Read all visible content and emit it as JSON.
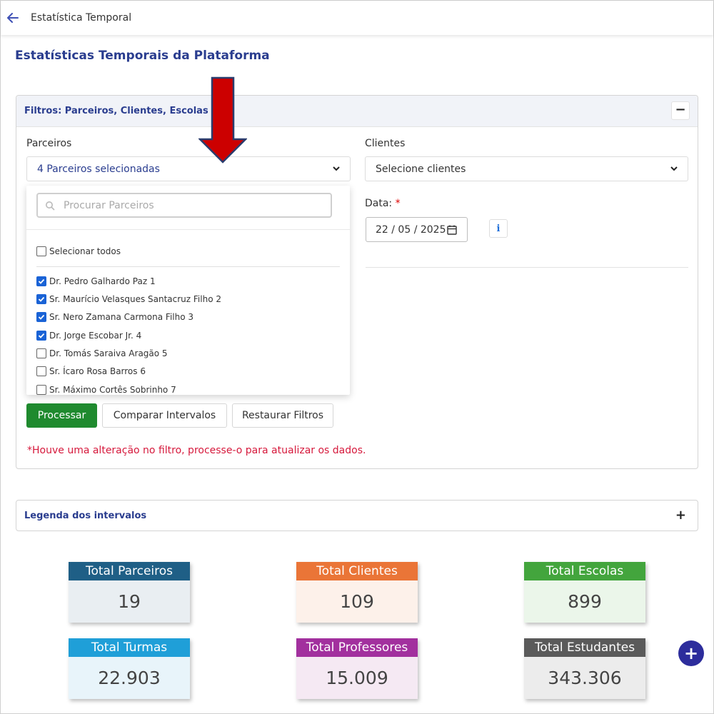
{
  "topbar": {
    "title": "Estatística Temporal"
  },
  "page": {
    "title": "Estatísticas Temporais da Plataforma"
  },
  "filters": {
    "header": "Filtros: Parceiros, Clientes, Escolas e D",
    "collapse_symbol": "−",
    "partners_label": "Parceiros",
    "partners_value": "4 Parceiros selecionadas",
    "clients_label": "Clientes",
    "clients_value": "Selecione clientes",
    "date_label": "Data:",
    "date_required": "*",
    "date_value": "22 / 05 / 2025",
    "info_symbol": "i",
    "dropdown": {
      "search_placeholder": "Procurar Parceiros",
      "select_all": "Selecionar todos",
      "items": [
        {
          "label": "Dr. Pedro Galhardo Paz 1",
          "checked": true
        },
        {
          "label": "Sr. Maurício Velasques Santacruz Filho 2",
          "checked": true
        },
        {
          "label": "Sr. Nero Zamana Carmona Filho 3",
          "checked": true
        },
        {
          "label": "Dr. Jorge Escobar Jr. 4",
          "checked": true
        },
        {
          "label": "Dr. Tomás Saraiva Aragão 5",
          "checked": false
        },
        {
          "label": "Sr. Ícaro Rosa Barros 6",
          "checked": false
        },
        {
          "label": "Sr. Máximo Cortês Sobrinho 7",
          "checked": false
        }
      ]
    },
    "buttons": {
      "process": "Processar",
      "compare": "Comparar Intervalos",
      "reset": "Restaurar Filtros"
    },
    "warning": "*Houve uma alteração no filtro, processe-o para atualizar os dados."
  },
  "legend": {
    "title": "Legenda dos intervalos",
    "expand_symbol": "+"
  },
  "stats": [
    {
      "label": "Total Parceiros",
      "value": "19",
      "header_color": "#1f5f86",
      "body_color": "#e9eef2"
    },
    {
      "label": "Total Clientes",
      "value": "109",
      "header_color": "#ea7537",
      "body_color": "#fdf1ea"
    },
    {
      "label": "Total Escolas",
      "value": "899",
      "header_color": "#43a53d",
      "body_color": "#ebf6ea"
    },
    {
      "label": "Total Turmas",
      "value": "22.903",
      "header_color": "#1f9fd8",
      "body_color": "#e8f4fa"
    },
    {
      "label": "Total Professores",
      "value": "15.009",
      "header_color": "#a2309e",
      "body_color": "#f5e9f3"
    },
    {
      "label": "Total Estudantes",
      "value": "343.306",
      "header_color": "#5a5a5a",
      "body_color": "#ececec"
    }
  ],
  "fab": {
    "symbol": "+"
  },
  "colors": {
    "accent": "#2a3d8f",
    "primary_button": "#1f8a2e",
    "warning": "#d6193c",
    "checkbox": "#1a63d6",
    "arrow": "#cc0000"
  }
}
